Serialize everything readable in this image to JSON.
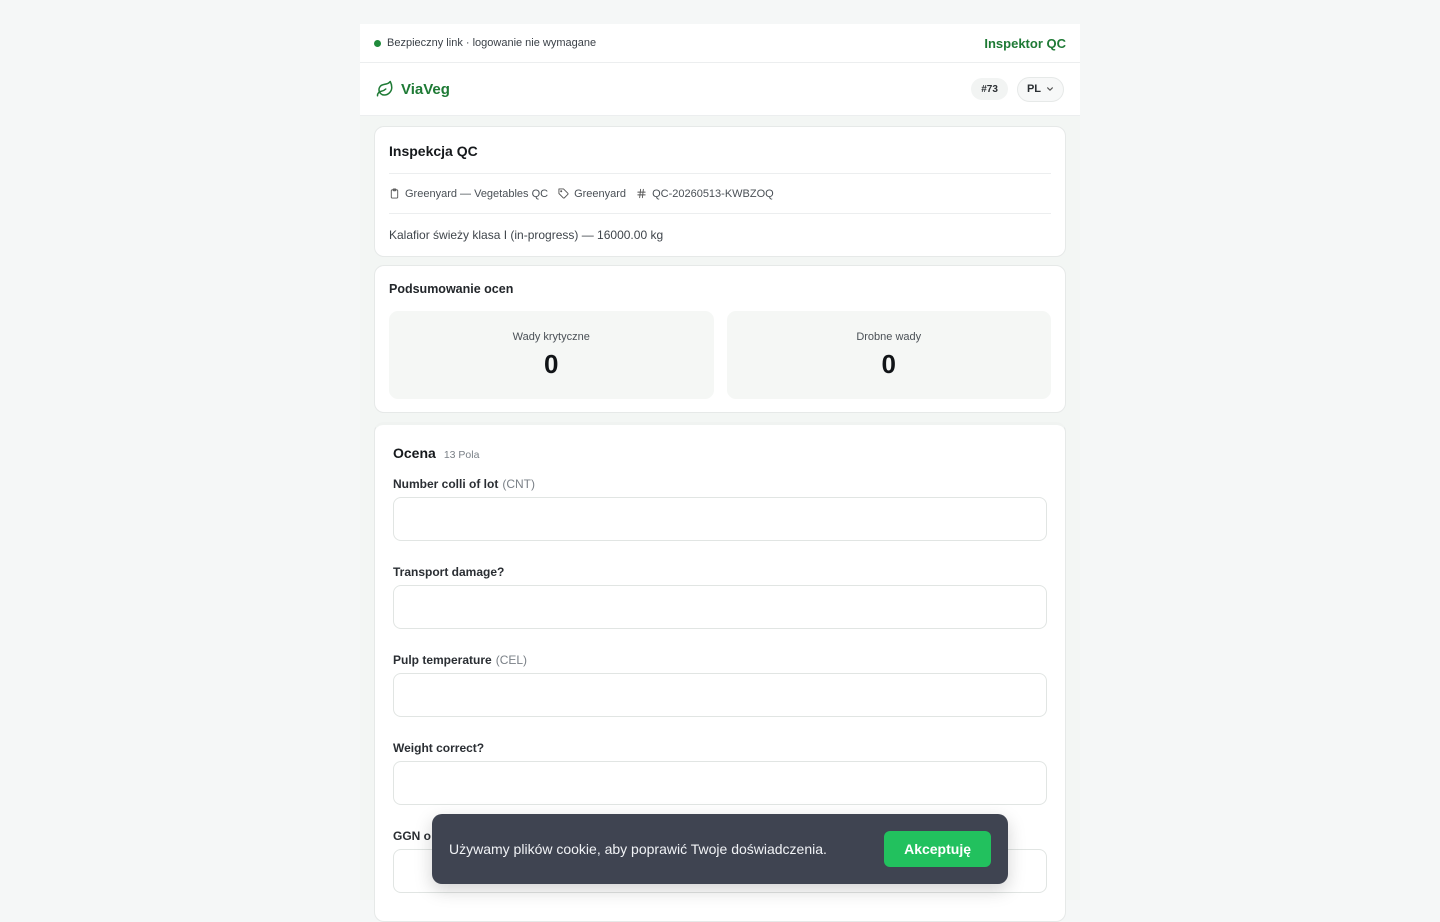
{
  "secure_bar": {
    "text": "Bezpieczny link · logowanie nie wymagane",
    "role": "Inspektor QC",
    "status_color": "#1f8a3b"
  },
  "header": {
    "brand": "ViaVeg",
    "brand_icon": "leaf-icon",
    "record_id": "#73",
    "language": "PL"
  },
  "inspection": {
    "title": "Inspekcja QC",
    "template": "Greenyard — Vegetables QC",
    "client": "Greenyard",
    "code": "QC-20260513-KWBZOQ",
    "product": "Kalafior świeży klasa I (in-progress) — 16000.00 kg"
  },
  "summary": {
    "title": "Podsumowanie ocen",
    "critical_label": "Wady krytyczne",
    "critical_value": "0",
    "minor_label": "Drobne wady",
    "minor_value": "0"
  },
  "form": {
    "title": "Ocena",
    "count": "13 Pola",
    "fields": [
      {
        "label": "Number colli of lot",
        "unit": "(CNT)",
        "value": ""
      },
      {
        "label": "Transport damage?",
        "unit": "",
        "value": ""
      },
      {
        "label": "Pulp temperature",
        "unit": "(CEL)",
        "value": ""
      },
      {
        "label": "Weight correct?",
        "unit": "",
        "value": ""
      },
      {
        "label": "GGN o",
        "unit": "",
        "value": ""
      }
    ]
  },
  "cookie": {
    "text": "Używamy plików cookie, aby poprawić Twoje doświadczenia.",
    "accept": "Akceptuję",
    "accent": "#22c15e"
  },
  "colors": {
    "brand_green": "#1e7a35"
  }
}
